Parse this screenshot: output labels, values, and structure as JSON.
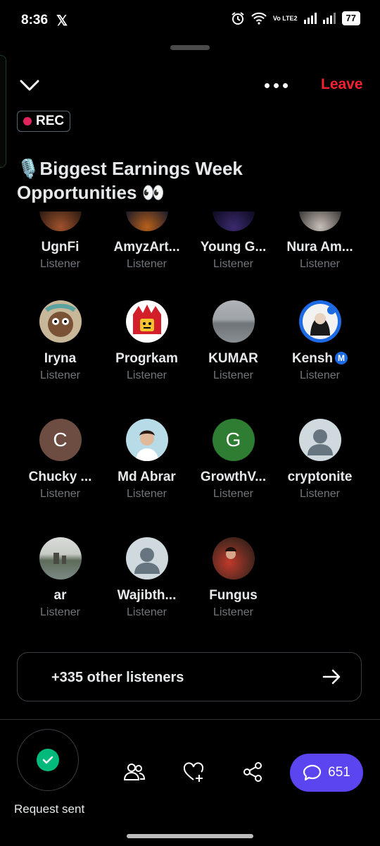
{
  "status_bar": {
    "time": "8:36",
    "app_icon": "x-logo",
    "battery": "77",
    "network": "Vo LTE2"
  },
  "header": {
    "leave_label": "Leave",
    "rec_label": "REC"
  },
  "space": {
    "title": "🎙️Biggest Earnings Week Opportunities 👀"
  },
  "participants": [
    {
      "name": "UgnFi",
      "role": "Listener"
    },
    {
      "name": "AmyzArt...",
      "role": "Listener"
    },
    {
      "name": "Young G...",
      "role": "Listener"
    },
    {
      "name": "Nura Am...",
      "role": "Listener"
    },
    {
      "name": "Iryna",
      "role": "Listener"
    },
    {
      "name": "Progrkam",
      "role": "Listener"
    },
    {
      "name": "KUMAR",
      "role": "Listener"
    },
    {
      "name": "Kensh",
      "role": "Listener"
    },
    {
      "name": "Chucky ...",
      "role": "Listener",
      "initial": "C"
    },
    {
      "name": "Md Abrar",
      "role": "Listener"
    },
    {
      "name": "GrowthV...",
      "role": "Listener",
      "initial": "G"
    },
    {
      "name": "cryptonite",
      "role": "Listener"
    },
    {
      "name": "ar",
      "role": "Listener"
    },
    {
      "name": "Wajibth...",
      "role": "Listener"
    },
    {
      "name": "Fungus",
      "role": "Listener"
    }
  ],
  "other_listeners": {
    "label": "+335 other listeners"
  },
  "bottom": {
    "request_label": "Request sent",
    "comment_count": "651"
  },
  "colors": {
    "leave": "#f4212e",
    "rec_dot": "#e0245e",
    "comment_button": "#5a45f0",
    "check": "#00ba7c"
  }
}
